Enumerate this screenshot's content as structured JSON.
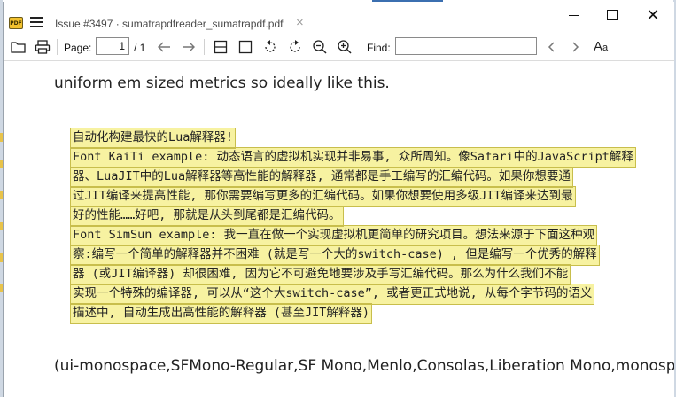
{
  "window": {
    "tab_title": "Issue #3497 · sumatrapdfreader_sumatrapdf.pdf",
    "tab_close": "×",
    "app_icon_text": "PDF",
    "close_glyph": "✕"
  },
  "toolbar": {
    "page_label": "Page:",
    "page_value": "1",
    "page_total": "/ 1",
    "find_label": "Find:",
    "find_value": "",
    "font_size_glyph": "A",
    "font_size_glyph_small": "a"
  },
  "document": {
    "paragraph": "uniform em sized metrics so ideally like this.",
    "code_lines": [
      "自动化构建最快的Lua解释器!",
      "Font KaiTi example: 动态语言的虚拟机实现并非易事, 众所周知。像Safari中的JavaScript解释",
      "器、LuaJIT中的Lua解释器等高性能的解释器, 通常都是手工编写的汇编代码。如果你想要通",
      "过JIT编译来提高性能, 那你需要编写更多的汇编代码。如果你想要使用多级JIT编译来达到最",
      "好的性能……好吧, 那就是从头到尾都是汇编代码。",
      "Font SimSun example: 我一直在做一个实现虚拟机更简单的研究项目。想法来源于下面这种观",
      "察:编写一个简单的解释器并不困难 (就是写一个大的switch-case) , 但是编写一个优秀的解释",
      "器 (或JIT编译器) 却很困难, 因为它不可避免地要涉及手写汇编代码。那么为什么我们不能",
      "实现一个特殊的编译器, 可以从“这个大switch-case”, 或者更正式地说, 从每个字节码的语义",
      "描述中, 自动生成出高性能的解释器 (甚至JIT解释器)"
    ],
    "font_list": "(ui-monospace,SFMono-Regular,SF Mono,Menlo,Consolas,Liberation Mono,monospace)"
  },
  "colors": {
    "highlight": "#f7f2a1",
    "highlight_border": "#c8be4c",
    "accent": "#3b6fb0"
  }
}
